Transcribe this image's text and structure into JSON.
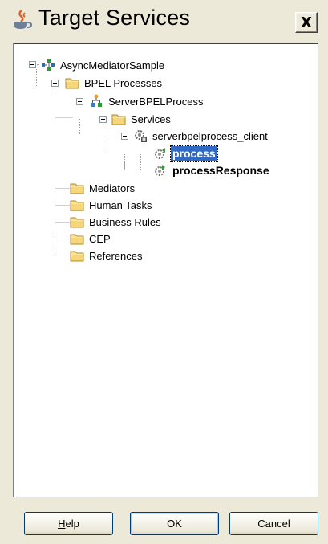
{
  "window": {
    "title": "Target Services",
    "close_label": "X",
    "title_icon": "java-coffee-cup-icon"
  },
  "tree": {
    "nodes": [
      {
        "label": "AsyncMediatorSample",
        "icon": "composite-project-icon",
        "expanded": true
      },
      {
        "label": "BPEL Processes",
        "icon": "folder-icon",
        "expanded": true
      },
      {
        "label": "ServerBPELProcess",
        "icon": "bpel-process-icon",
        "expanded": true
      },
      {
        "label": "Services",
        "icon": "folder-icon",
        "expanded": true
      },
      {
        "label": "serverbpelprocess_client",
        "icon": "service-gear-icon",
        "expanded": true
      },
      {
        "label": "process",
        "icon": "operation-gear-icon",
        "selected": true
      },
      {
        "label": "processResponse",
        "icon": "operation-gear-icon"
      },
      {
        "label": "Mediators",
        "icon": "folder-icon"
      },
      {
        "label": "Human Tasks",
        "icon": "folder-icon"
      },
      {
        "label": "Business Rules",
        "icon": "folder-icon"
      },
      {
        "label": "CEP",
        "icon": "folder-icon"
      },
      {
        "label": "References",
        "icon": "folder-icon"
      }
    ]
  },
  "buttons": {
    "help": {
      "prefix": "",
      "mnemonic": "H",
      "suffix": "elp"
    },
    "ok": "OK",
    "cancel": "Cancel"
  },
  "colors": {
    "dialog_bg": "#ece9d8",
    "selection": "#316ac5",
    "folder": "#f5d77a"
  }
}
